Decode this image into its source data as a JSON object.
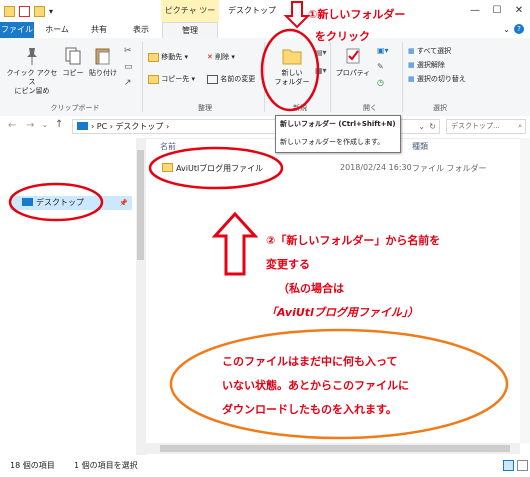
{
  "titlebar": {
    "context_tab": "ピクチャ ツール",
    "title": "デスクトップ",
    "minimize": "—",
    "maximize": "☐",
    "close": "✕"
  },
  "tabs": {
    "file": "ファイル",
    "home": "ホーム",
    "share": "共有",
    "view": "表示",
    "manage": "管理"
  },
  "ribbon": {
    "quick_access": "クイック アクセス\nにピン留め",
    "copy": "コピー",
    "paste": "貼り付け",
    "clipboard_group": "クリップボード",
    "move_to": "移動先 ▾",
    "delete": "削除 ▾",
    "copy_to": "コピー先 ▾",
    "rename": "名前の変更",
    "organize_group": "整理",
    "new_folder": "新しい\nフォルダー",
    "new_group": "新規",
    "properties": "プロパティ",
    "open_group": "開く",
    "select_all": "すべて選択",
    "select_none": "選択解除",
    "invert_selection": "選択の切り替え",
    "select_group": "選択"
  },
  "tooltip": {
    "title": "新しいフォルダー (Ctrl+Shift+N)",
    "desc": "新しいフォルダーを作成します。"
  },
  "address": {
    "path": "› PC › デスクトップ ›",
    "search_placeholder": "デスクトップ..."
  },
  "nav": {
    "desktop": "デスクトップ"
  },
  "columns": {
    "name": "名前",
    "type": "種類"
  },
  "file": {
    "name": "AviUtlブログ用ファイル",
    "date": "2018/02/24 16:30",
    "type": "ファイル フォルダー"
  },
  "status": {
    "count": "18 個の項目",
    "selected": "1 個の項目を選択"
  },
  "annotations": {
    "step1_line1": "①新しいフォルダー",
    "step1_line2": "をクリック",
    "step2_line1": "②「新しいフォルダー」から名前を",
    "step2_line2": "変更する",
    "step2_line3": "（私の場合は",
    "step2_line4": "「AviUtlブログ用ファイル」）",
    "note_line1": "このファイルはまだ中に何も入って",
    "note_line2": "いない状態。あとからこのファイルに",
    "note_line3": "ダウンロードしたものを入れます。"
  },
  "colors": {
    "annotation_red": "#e60012",
    "annotation_orange": "#f07b1a",
    "file_tab": "#1979ca",
    "context_tab": "#fff3b8"
  }
}
